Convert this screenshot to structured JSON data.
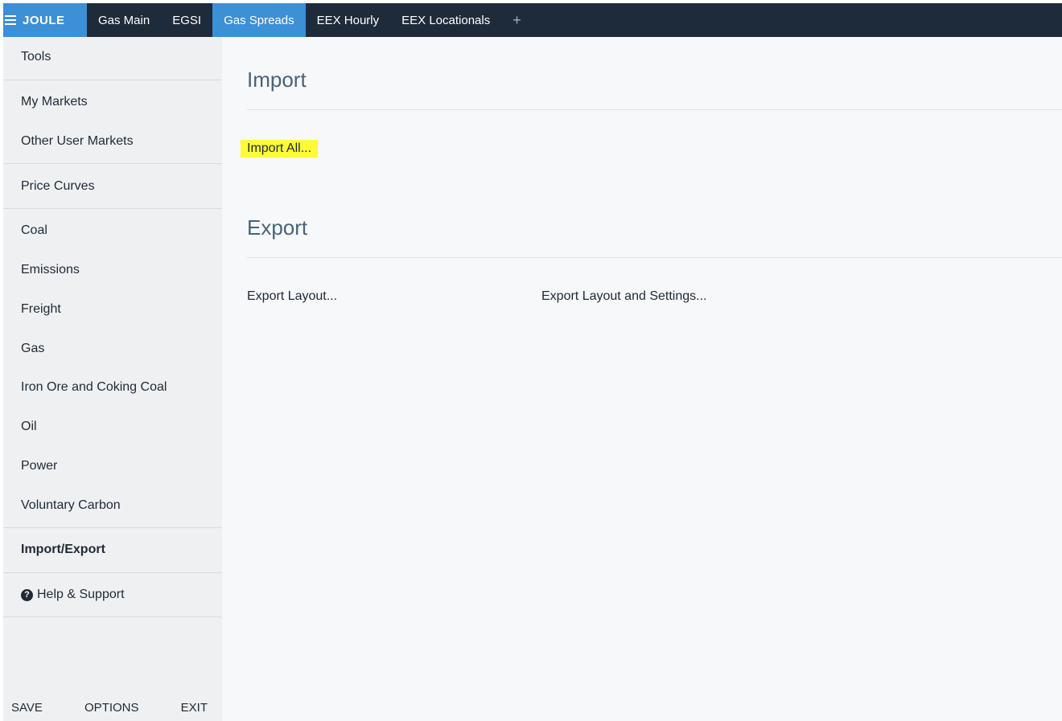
{
  "topbar": {
    "brand": "JOULE",
    "tabs": [
      {
        "label": "Gas Main",
        "active": false
      },
      {
        "label": "EGSI",
        "active": false
      },
      {
        "label": "Gas Spreads",
        "active": true
      },
      {
        "label": "EEX Hourly",
        "active": false
      },
      {
        "label": "EEX Locationals",
        "active": false
      }
    ],
    "add_tab": "+"
  },
  "sidebar": {
    "items": [
      {
        "label": "Tools"
      },
      {
        "label": "My Markets"
      },
      {
        "label": "Other User Markets"
      },
      {
        "label": "Price Curves"
      },
      {
        "label": "Coal"
      },
      {
        "label": "Emissions"
      },
      {
        "label": "Freight"
      },
      {
        "label": "Gas"
      },
      {
        "label": "Iron Ore and Coking Coal"
      },
      {
        "label": "Oil"
      },
      {
        "label": "Power"
      },
      {
        "label": "Voluntary Carbon"
      },
      {
        "label": "Import/Export",
        "selected": true
      },
      {
        "label": "Help & Support",
        "icon": "question-circle-icon"
      }
    ],
    "footer": {
      "save": "SAVE",
      "options": "OPTIONS",
      "exit": "EXIT"
    }
  },
  "main": {
    "import": {
      "title": "Import",
      "import_all": "Import All..."
    },
    "export": {
      "title": "Export",
      "export_layout": "Export Layout...",
      "export_layout_settings": "Export Layout and Settings..."
    }
  },
  "colors": {
    "topbar_bg": "#1e2b3a",
    "accent": "#3d8fd6",
    "highlight": "#fdfb36",
    "sidebar_bg": "#eef0f2",
    "main_bg": "#f7f8fa"
  }
}
